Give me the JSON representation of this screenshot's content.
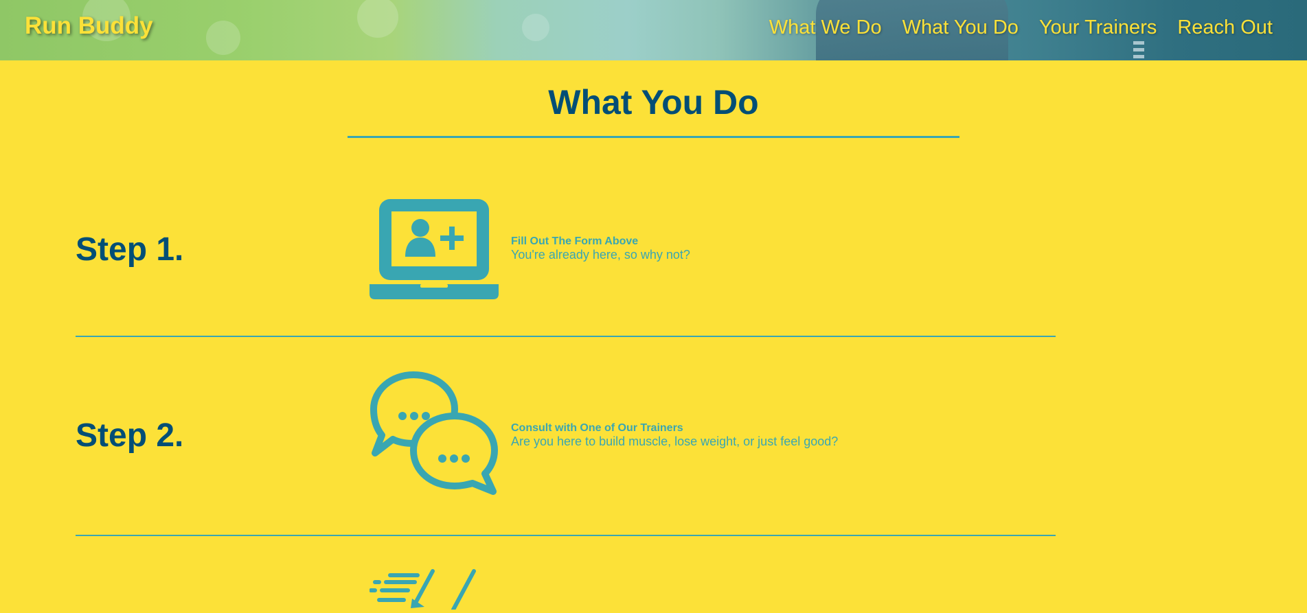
{
  "header": {
    "brand": "Run Buddy",
    "nav": [
      "What We Do",
      "What You Do",
      "Your Trainers",
      "Reach Out"
    ]
  },
  "section": {
    "title": "What You Do"
  },
  "steps": [
    {
      "label": "Step 1.",
      "icon": "laptop-add-user-icon",
      "heading": "Fill Out The Form Above",
      "description": "You're already here, so why not?"
    },
    {
      "label": "Step 2.",
      "icon": "chat-bubbles-icon",
      "heading": "Consult with One of Our Trainers",
      "description": "Are you here to build muscle, lose weight, or just feel good?"
    },
    {
      "label": "",
      "icon": "running-shoe-icon",
      "heading": "",
      "description": ""
    }
  ],
  "colors": {
    "background": "#fce138",
    "primary": "#024e76",
    "accent": "#39a6b2"
  }
}
